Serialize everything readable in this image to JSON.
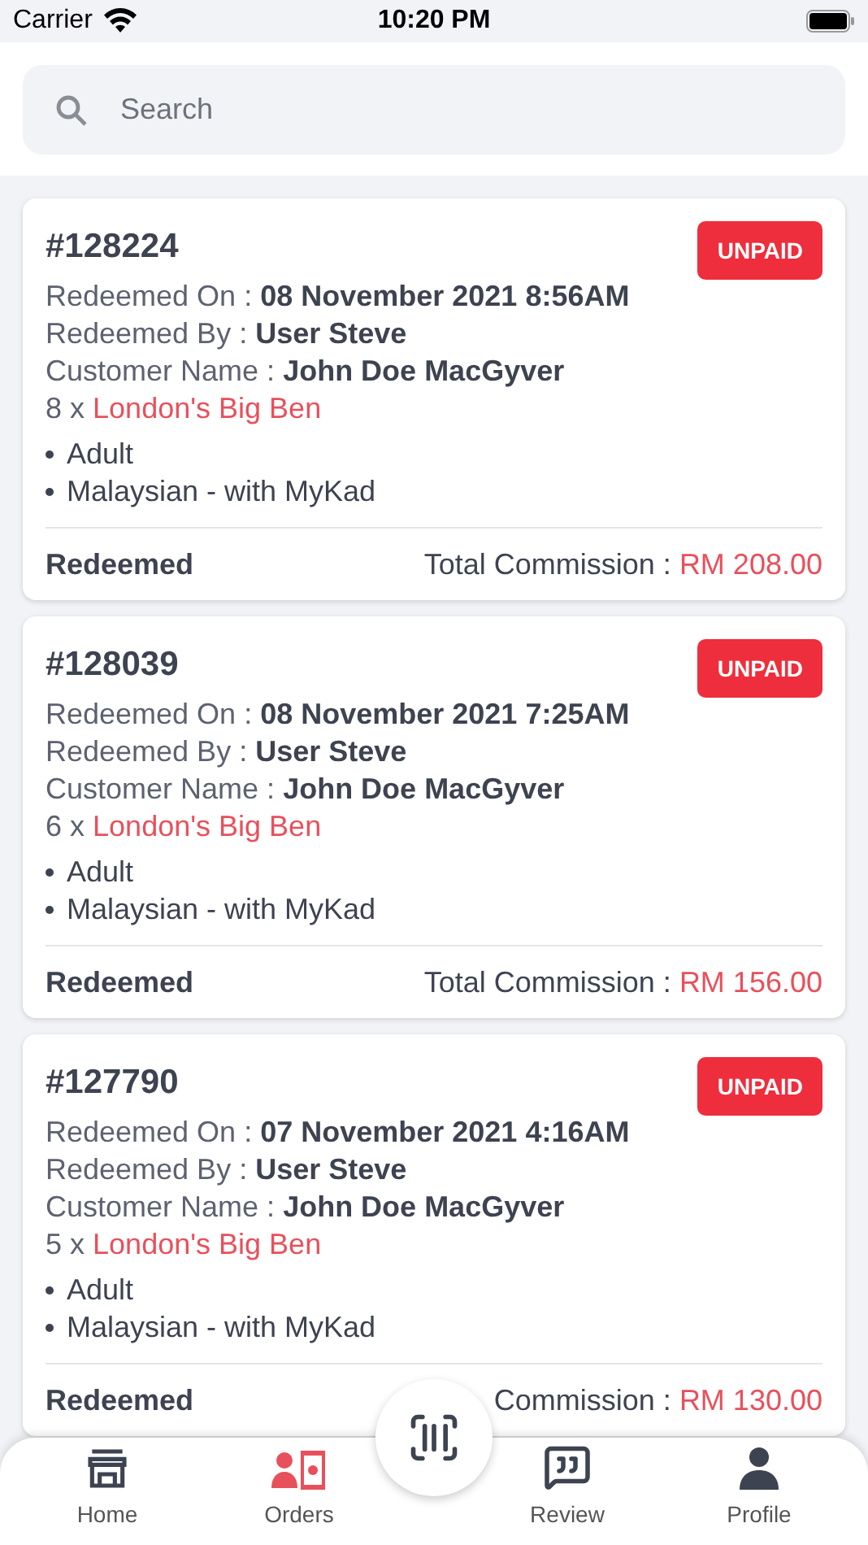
{
  "status_bar": {
    "carrier": "Carrier",
    "time": "10:20 PM"
  },
  "search": {
    "placeholder": "Search"
  },
  "orders": [
    {
      "number": "#128224",
      "badge": "UNPAID",
      "details": [
        {
          "label": "Redeemed On :",
          "value": "08 November 2021 8:56AM"
        },
        {
          "label": "Redeemed By :",
          "value": "User Steve"
        },
        {
          "label": "Customer Name :",
          "value": "John Doe MacGyver"
        }
      ],
      "quantity": "8 x",
      "product": "London's Big Ben",
      "options": [
        "Adult",
        "Malaysian - with MyKad"
      ],
      "status": "Redeemed",
      "commission_label": "Total Commission :",
      "commission": "RM 208.00"
    },
    {
      "number": "#128039",
      "badge": "UNPAID",
      "details": [
        {
          "label": "Redeemed On :",
          "value": "08 November 2021 7:25AM"
        },
        {
          "label": "Redeemed By :",
          "value": "User Steve"
        },
        {
          "label": "Customer Name :",
          "value": "John Doe MacGyver"
        }
      ],
      "quantity": "6 x",
      "product": "London's Big Ben",
      "options": [
        "Adult",
        "Malaysian - with MyKad"
      ],
      "status": "Redeemed",
      "commission_label": "Total Commission :",
      "commission": "RM 156.00"
    },
    {
      "number": "#127790",
      "badge": "UNPAID",
      "details": [
        {
          "label": "Redeemed On :",
          "value": "07 November 2021 4:16AM"
        },
        {
          "label": "Redeemed By :",
          "value": "User Steve"
        },
        {
          "label": "Customer Name :",
          "value": "John Doe MacGyver"
        }
      ],
      "quantity": "5 x",
      "product": "London's Big Ben",
      "options": [
        "Adult",
        "Malaysian - with MyKad"
      ],
      "status": "Redeemed",
      "commission_label": "Commission :",
      "commission": "RM 130.00"
    }
  ],
  "tab_bar": [
    {
      "kind": "home",
      "label": "Home",
      "selected": false
    },
    {
      "kind": "orders",
      "label": "Orders",
      "selected": true
    },
    {
      "kind": "scan"
    },
    {
      "kind": "review",
      "label": "Review",
      "selected": false
    },
    {
      "kind": "profile",
      "label": "Profile",
      "selected": false
    }
  ]
}
